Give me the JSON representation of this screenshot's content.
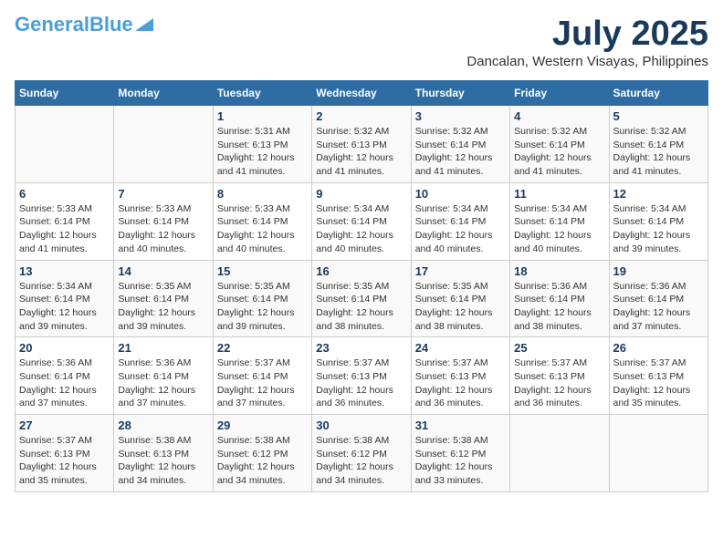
{
  "header": {
    "logo_general": "General",
    "logo_blue": "Blue",
    "month": "July 2025",
    "location": "Dancalan, Western Visayas, Philippines"
  },
  "days_of_week": [
    "Sunday",
    "Monday",
    "Tuesday",
    "Wednesday",
    "Thursday",
    "Friday",
    "Saturday"
  ],
  "weeks": [
    [
      {
        "day": "",
        "sunrise": "",
        "sunset": "",
        "daylight": ""
      },
      {
        "day": "",
        "sunrise": "",
        "sunset": "",
        "daylight": ""
      },
      {
        "day": "1",
        "sunrise": "Sunrise: 5:31 AM",
        "sunset": "Sunset: 6:13 PM",
        "daylight": "Daylight: 12 hours and 41 minutes."
      },
      {
        "day": "2",
        "sunrise": "Sunrise: 5:32 AM",
        "sunset": "Sunset: 6:13 PM",
        "daylight": "Daylight: 12 hours and 41 minutes."
      },
      {
        "day": "3",
        "sunrise": "Sunrise: 5:32 AM",
        "sunset": "Sunset: 6:14 PM",
        "daylight": "Daylight: 12 hours and 41 minutes."
      },
      {
        "day": "4",
        "sunrise": "Sunrise: 5:32 AM",
        "sunset": "Sunset: 6:14 PM",
        "daylight": "Daylight: 12 hours and 41 minutes."
      },
      {
        "day": "5",
        "sunrise": "Sunrise: 5:32 AM",
        "sunset": "Sunset: 6:14 PM",
        "daylight": "Daylight: 12 hours and 41 minutes."
      }
    ],
    [
      {
        "day": "6",
        "sunrise": "Sunrise: 5:33 AM",
        "sunset": "Sunset: 6:14 PM",
        "daylight": "Daylight: 12 hours and 41 minutes."
      },
      {
        "day": "7",
        "sunrise": "Sunrise: 5:33 AM",
        "sunset": "Sunset: 6:14 PM",
        "daylight": "Daylight: 12 hours and 40 minutes."
      },
      {
        "day": "8",
        "sunrise": "Sunrise: 5:33 AM",
        "sunset": "Sunset: 6:14 PM",
        "daylight": "Daylight: 12 hours and 40 minutes."
      },
      {
        "day": "9",
        "sunrise": "Sunrise: 5:34 AM",
        "sunset": "Sunset: 6:14 PM",
        "daylight": "Daylight: 12 hours and 40 minutes."
      },
      {
        "day": "10",
        "sunrise": "Sunrise: 5:34 AM",
        "sunset": "Sunset: 6:14 PM",
        "daylight": "Daylight: 12 hours and 40 minutes."
      },
      {
        "day": "11",
        "sunrise": "Sunrise: 5:34 AM",
        "sunset": "Sunset: 6:14 PM",
        "daylight": "Daylight: 12 hours and 40 minutes."
      },
      {
        "day": "12",
        "sunrise": "Sunrise: 5:34 AM",
        "sunset": "Sunset: 6:14 PM",
        "daylight": "Daylight: 12 hours and 39 minutes."
      }
    ],
    [
      {
        "day": "13",
        "sunrise": "Sunrise: 5:34 AM",
        "sunset": "Sunset: 6:14 PM",
        "daylight": "Daylight: 12 hours and 39 minutes."
      },
      {
        "day": "14",
        "sunrise": "Sunrise: 5:35 AM",
        "sunset": "Sunset: 6:14 PM",
        "daylight": "Daylight: 12 hours and 39 minutes."
      },
      {
        "day": "15",
        "sunrise": "Sunrise: 5:35 AM",
        "sunset": "Sunset: 6:14 PM",
        "daylight": "Daylight: 12 hours and 39 minutes."
      },
      {
        "day": "16",
        "sunrise": "Sunrise: 5:35 AM",
        "sunset": "Sunset: 6:14 PM",
        "daylight": "Daylight: 12 hours and 38 minutes."
      },
      {
        "day": "17",
        "sunrise": "Sunrise: 5:35 AM",
        "sunset": "Sunset: 6:14 PM",
        "daylight": "Daylight: 12 hours and 38 minutes."
      },
      {
        "day": "18",
        "sunrise": "Sunrise: 5:36 AM",
        "sunset": "Sunset: 6:14 PM",
        "daylight": "Daylight: 12 hours and 38 minutes."
      },
      {
        "day": "19",
        "sunrise": "Sunrise: 5:36 AM",
        "sunset": "Sunset: 6:14 PM",
        "daylight": "Daylight: 12 hours and 37 minutes."
      }
    ],
    [
      {
        "day": "20",
        "sunrise": "Sunrise: 5:36 AM",
        "sunset": "Sunset: 6:14 PM",
        "daylight": "Daylight: 12 hours and 37 minutes."
      },
      {
        "day": "21",
        "sunrise": "Sunrise: 5:36 AM",
        "sunset": "Sunset: 6:14 PM",
        "daylight": "Daylight: 12 hours and 37 minutes."
      },
      {
        "day": "22",
        "sunrise": "Sunrise: 5:37 AM",
        "sunset": "Sunset: 6:14 PM",
        "daylight": "Daylight: 12 hours and 37 minutes."
      },
      {
        "day": "23",
        "sunrise": "Sunrise: 5:37 AM",
        "sunset": "Sunset: 6:13 PM",
        "daylight": "Daylight: 12 hours and 36 minutes."
      },
      {
        "day": "24",
        "sunrise": "Sunrise: 5:37 AM",
        "sunset": "Sunset: 6:13 PM",
        "daylight": "Daylight: 12 hours and 36 minutes."
      },
      {
        "day": "25",
        "sunrise": "Sunrise: 5:37 AM",
        "sunset": "Sunset: 6:13 PM",
        "daylight": "Daylight: 12 hours and 36 minutes."
      },
      {
        "day": "26",
        "sunrise": "Sunrise: 5:37 AM",
        "sunset": "Sunset: 6:13 PM",
        "daylight": "Daylight: 12 hours and 35 minutes."
      }
    ],
    [
      {
        "day": "27",
        "sunrise": "Sunrise: 5:37 AM",
        "sunset": "Sunset: 6:13 PM",
        "daylight": "Daylight: 12 hours and 35 minutes."
      },
      {
        "day": "28",
        "sunrise": "Sunrise: 5:38 AM",
        "sunset": "Sunset: 6:13 PM",
        "daylight": "Daylight: 12 hours and 34 minutes."
      },
      {
        "day": "29",
        "sunrise": "Sunrise: 5:38 AM",
        "sunset": "Sunset: 6:12 PM",
        "daylight": "Daylight: 12 hours and 34 minutes."
      },
      {
        "day": "30",
        "sunrise": "Sunrise: 5:38 AM",
        "sunset": "Sunset: 6:12 PM",
        "daylight": "Daylight: 12 hours and 34 minutes."
      },
      {
        "day": "31",
        "sunrise": "Sunrise: 5:38 AM",
        "sunset": "Sunset: 6:12 PM",
        "daylight": "Daylight: 12 hours and 33 minutes."
      },
      {
        "day": "",
        "sunrise": "",
        "sunset": "",
        "daylight": ""
      },
      {
        "day": "",
        "sunrise": "",
        "sunset": "",
        "daylight": ""
      }
    ]
  ]
}
